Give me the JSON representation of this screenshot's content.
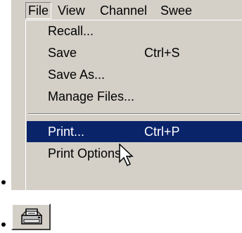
{
  "menubar": {
    "items": [
      {
        "label": "File"
      },
      {
        "label": "View"
      },
      {
        "label": "Channel"
      },
      {
        "label": "Swee"
      }
    ]
  },
  "file_menu": {
    "items": [
      {
        "label": "Recall...",
        "shortcut": ""
      },
      {
        "label": "Save",
        "shortcut": "Ctrl+S"
      },
      {
        "label": "Save As...",
        "shortcut": ""
      },
      {
        "label": "Manage Files...",
        "shortcut": ""
      },
      {
        "label": "Print...",
        "shortcut": "Ctrl+P",
        "highlighted": true
      },
      {
        "label": "Print Options...",
        "shortcut": ""
      }
    ]
  },
  "toolbar": {
    "print_icon": "printer-icon"
  },
  "colors": {
    "menu_background": "#d4d0c8",
    "highlight_background": "#0a246a",
    "highlight_text": "#ffffff"
  }
}
